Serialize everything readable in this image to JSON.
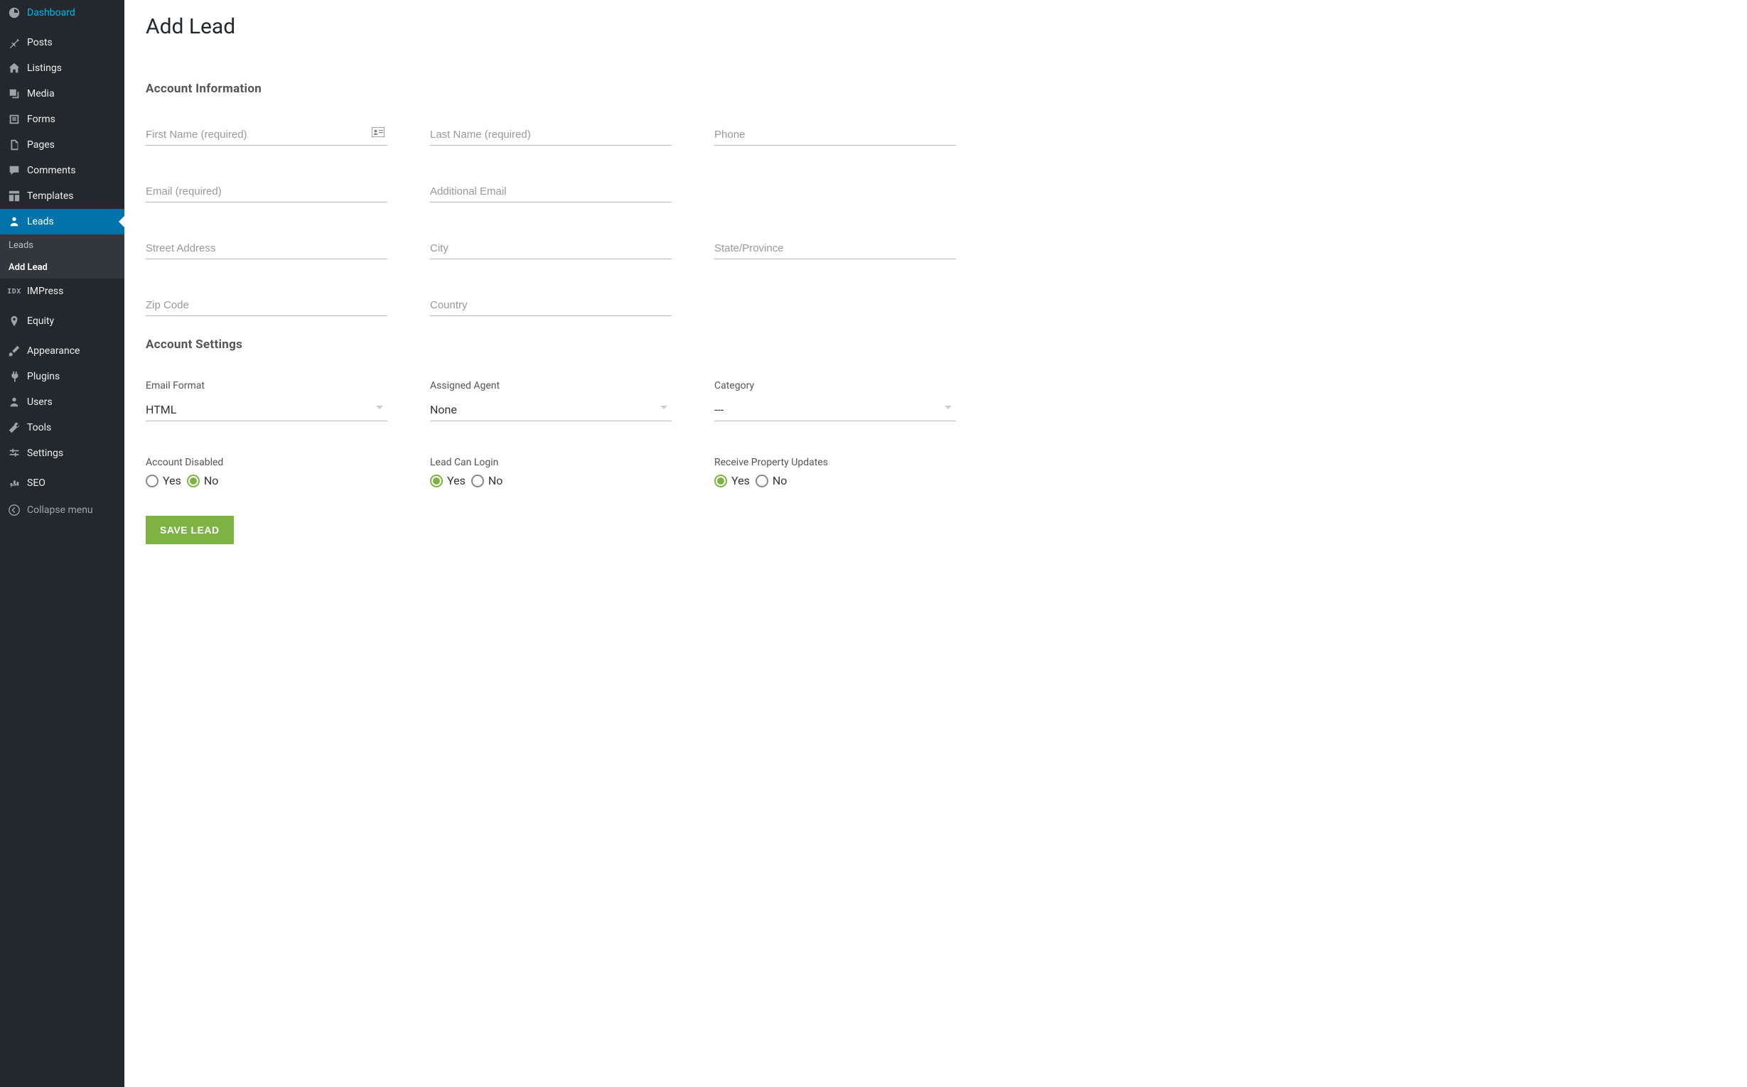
{
  "sidebar": {
    "items": [
      {
        "id": "dashboard",
        "label": "Dashboard",
        "icon": "dashboard"
      },
      {
        "sep": true
      },
      {
        "id": "posts",
        "label": "Posts",
        "icon": "pin"
      },
      {
        "id": "listings",
        "label": "Listings",
        "icon": "home"
      },
      {
        "id": "media",
        "label": "Media",
        "icon": "media"
      },
      {
        "id": "forms",
        "label": "Forms",
        "icon": "forms"
      },
      {
        "id": "pages",
        "label": "Pages",
        "icon": "pages"
      },
      {
        "id": "comments",
        "label": "Comments",
        "icon": "comment"
      },
      {
        "id": "templates",
        "label": "Templates",
        "icon": "templates"
      },
      {
        "id": "leads",
        "label": "Leads",
        "icon": "user",
        "active": true,
        "subitems": [
          {
            "id": "leads-list",
            "label": "Leads"
          },
          {
            "id": "add-lead",
            "label": "Add Lead",
            "current": true
          }
        ]
      },
      {
        "id": "impress",
        "label": "IMPress",
        "icon": "idx"
      },
      {
        "sep": true
      },
      {
        "id": "equity",
        "label": "Equity",
        "icon": "marker"
      },
      {
        "sep": true
      },
      {
        "id": "appearance",
        "label": "Appearance",
        "icon": "brush"
      },
      {
        "id": "plugins",
        "label": "Plugins",
        "icon": "plug"
      },
      {
        "id": "users",
        "label": "Users",
        "icon": "users"
      },
      {
        "id": "tools",
        "label": "Tools",
        "icon": "wrench"
      },
      {
        "id": "settings",
        "label": "Settings",
        "icon": "sliders"
      },
      {
        "sep": true
      },
      {
        "id": "seo",
        "label": "SEO",
        "icon": "seo"
      }
    ],
    "collapse_label": "Collapse menu"
  },
  "page": {
    "title": "Add Lead",
    "section_account_info": "Account Information",
    "section_account_settings": "Account Settings",
    "fields": {
      "first_name": "First Name (required)",
      "last_name": "Last Name (required)",
      "phone": "Phone",
      "email": "Email (required)",
      "additional_email": "Additional Email",
      "street": "Street Address",
      "city": "City",
      "state": "State/Province",
      "zip": "Zip Code",
      "country": "Country"
    },
    "selects": {
      "email_format": {
        "label": "Email Format",
        "value": "HTML"
      },
      "assigned_agent": {
        "label": "Assigned Agent",
        "value": "None"
      },
      "category": {
        "label": "Category",
        "value": "---"
      }
    },
    "radios": {
      "account_disabled": {
        "label": "Account Disabled",
        "yes": "Yes",
        "no": "No",
        "selected": "no"
      },
      "lead_can_login": {
        "label": "Lead Can Login",
        "yes": "Yes",
        "no": "No",
        "selected": "yes"
      },
      "receive_updates": {
        "label": "Receive Property Updates",
        "yes": "Yes",
        "no": "No",
        "selected": "yes"
      }
    },
    "save_button": "SAVE LEAD"
  }
}
